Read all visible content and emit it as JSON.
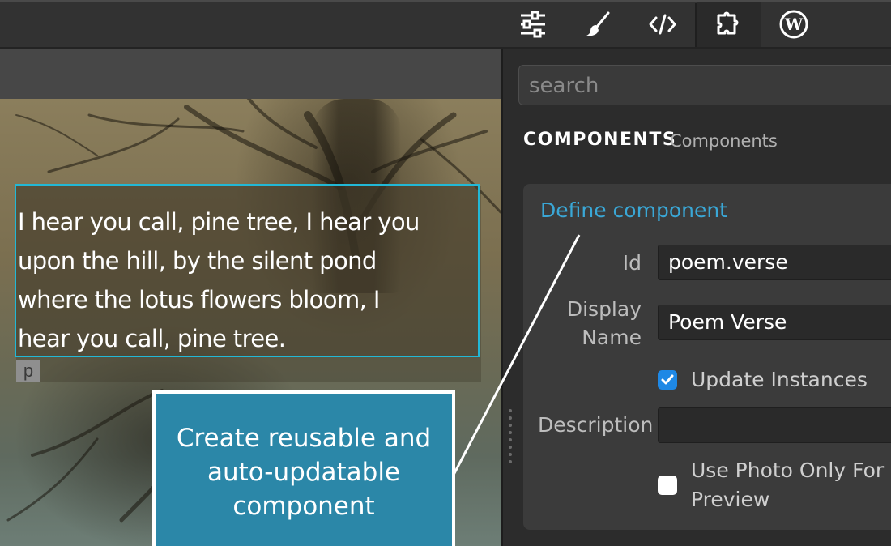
{
  "toolbar": {
    "tabs": [
      {
        "icon": "sliders-icon",
        "label": "Settings"
      },
      {
        "icon": "brush-icon",
        "label": "Styles"
      },
      {
        "icon": "code-icon",
        "label": "Code"
      },
      {
        "icon": "puzzle-icon",
        "label": "Components"
      },
      {
        "icon": "wordpress-icon",
        "label": "WordPress"
      }
    ],
    "active_tab": "puzzle-icon"
  },
  "canvas": {
    "poem_lines": [
      "I hear you call, pine tree, I hear you",
      "upon the hill, by the silent pond",
      "where the lotus flowers bloom, I",
      "hear you call, pine tree."
    ],
    "element_tag": "p",
    "highlight_color": "#22b8d6"
  },
  "callout": {
    "lines": [
      "Create reusable and",
      "auto-updatable",
      "component"
    ],
    "background": "#2b87a8"
  },
  "panel": {
    "search": {
      "placeholder": "search",
      "value": ""
    },
    "section_title": "COMPONENTS",
    "section_subtitle": "Components",
    "define": {
      "title": "Define component",
      "id_label": "Id",
      "id_value": "poem.verse",
      "display_name_label_1": "Display",
      "display_name_label_2": "Name",
      "display_name_value": "Poem Verse",
      "update_instances_label": "Update Instances",
      "update_instances_checked": true,
      "description_label": "Description",
      "description_value": "",
      "use_photo_label_1": "Use Photo Only For",
      "use_photo_label_2": "Preview",
      "use_photo_checked": false
    },
    "accent_color": "#3aa7d6"
  }
}
